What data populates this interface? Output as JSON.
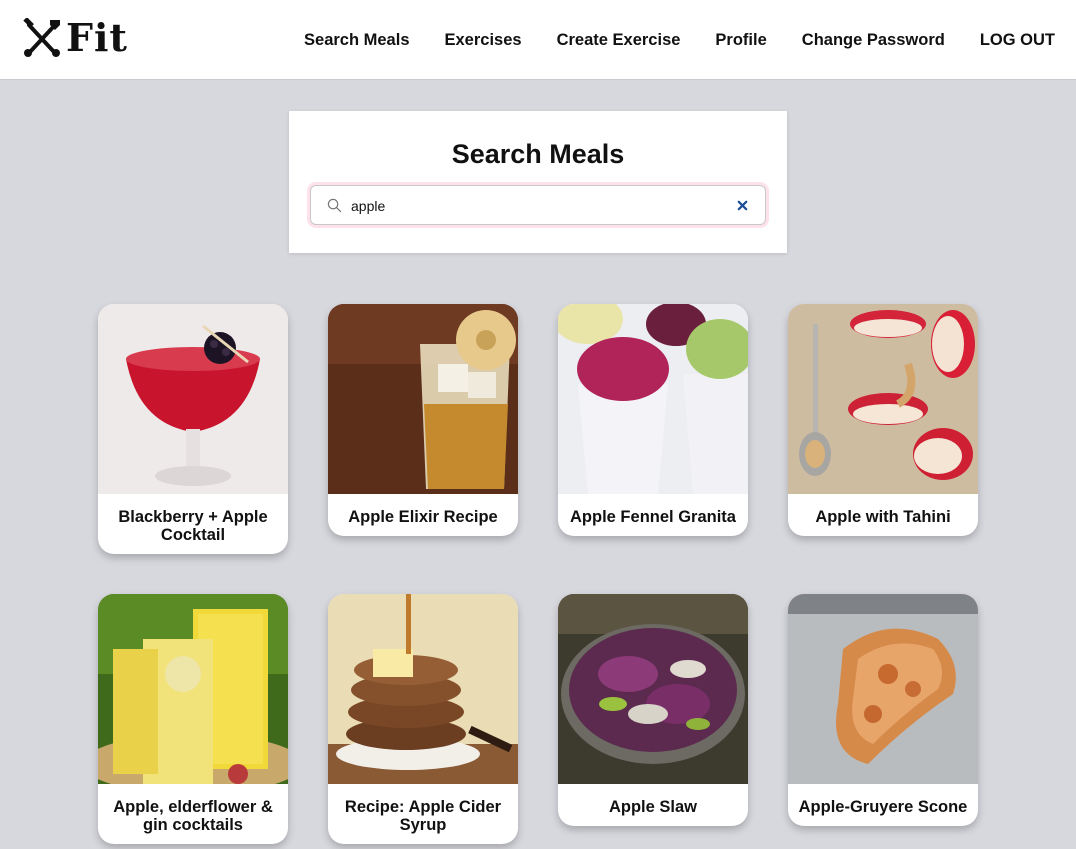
{
  "app": {
    "logo_text": "Fit"
  },
  "nav": {
    "links": [
      {
        "label": "Search Meals"
      },
      {
        "label": "Exercises"
      },
      {
        "label": "Create Exercise"
      },
      {
        "label": "Profile"
      },
      {
        "label": "Change Password"
      },
      {
        "label": "LOG OUT"
      }
    ]
  },
  "search": {
    "title": "Search Meals",
    "value": "apple",
    "accent_color": "#1f4e96"
  },
  "meals": [
    {
      "title": "Blackberry + Apple Cocktail",
      "image": "red cocktail with blackberry garnish"
    },
    {
      "title": "Apple Elixir Recipe",
      "image": "iced amber drink with dried apple slice"
    },
    {
      "title": "Apple Fennel Granita",
      "image": "cups of pink and green shaved ice"
    },
    {
      "title": "Apple with Tahini",
      "image": "apple slices drizzled with tahini"
    },
    {
      "title": "Apple, elderflower & gin cocktails",
      "image": "glasses of pale yellow cocktails"
    },
    {
      "title": "Recipe: Apple Cider Syrup",
      "image": "pancake stack with syrup and butter"
    },
    {
      "title": "Apple Slaw",
      "image": "bowl of purple cabbage slaw"
    },
    {
      "title": "Apple-Gruyere Scone",
      "image": "golden scone on grey plate"
    }
  ]
}
